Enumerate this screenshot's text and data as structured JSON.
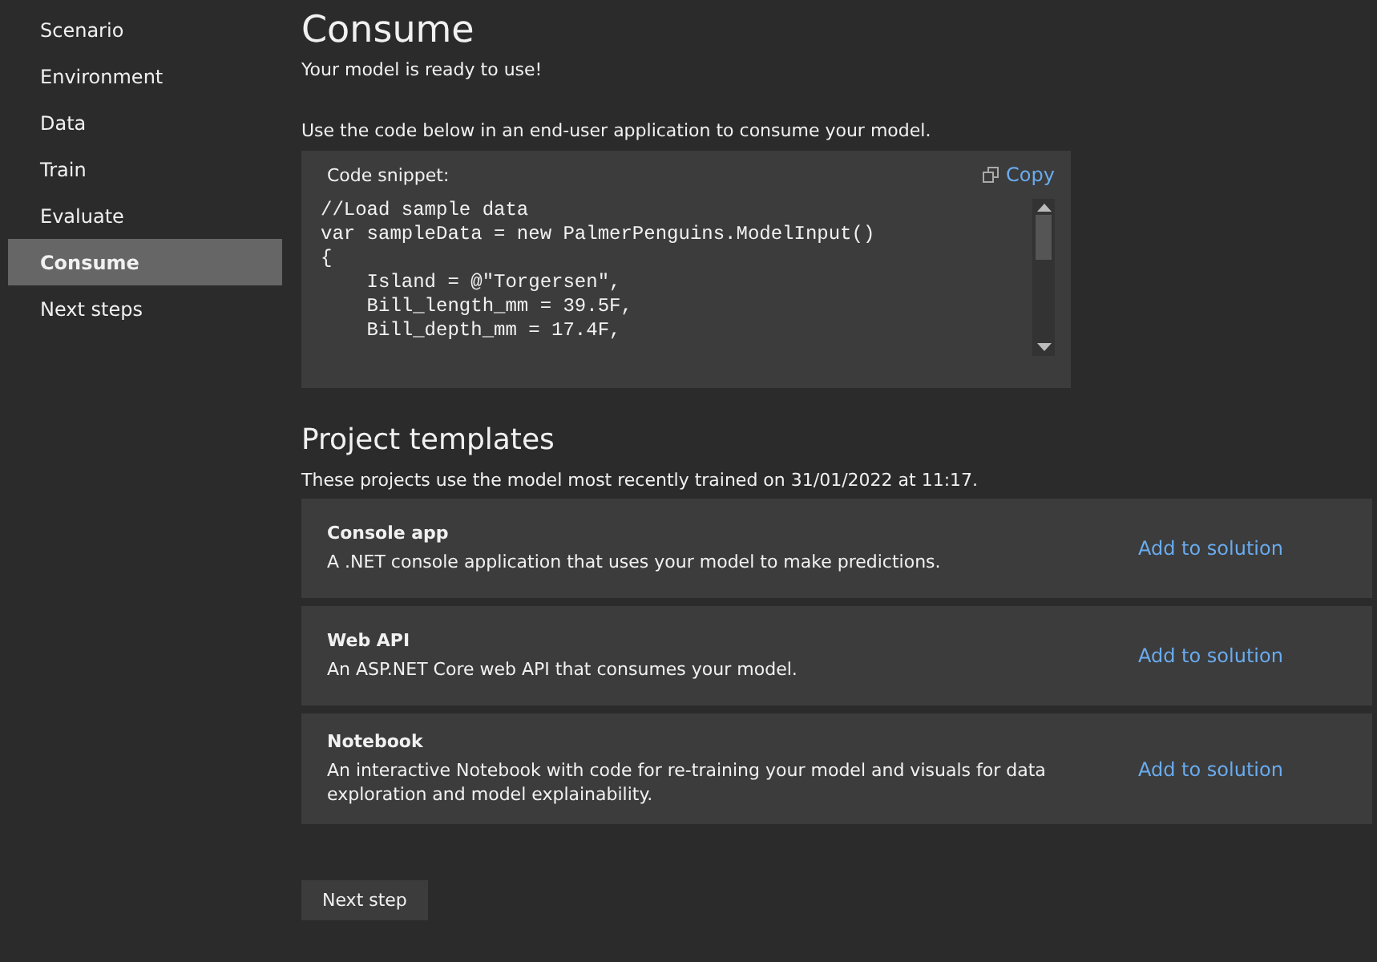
{
  "sidebar": {
    "items": [
      {
        "label": "Scenario",
        "selected": false
      },
      {
        "label": "Environment",
        "selected": false
      },
      {
        "label": "Data",
        "selected": false
      },
      {
        "label": "Train",
        "selected": false
      },
      {
        "label": "Evaluate",
        "selected": false
      },
      {
        "label": "Consume",
        "selected": true
      },
      {
        "label": "Next steps",
        "selected": false
      }
    ]
  },
  "page": {
    "title": "Consume",
    "subtitle": "Your model is ready to use!",
    "instruction": "Use the code below in an end-user application to consume your model."
  },
  "code_snippet": {
    "label": "Code snippet:",
    "copy_label": "Copy",
    "lines": [
      "//Load sample data",
      "var sampleData = new PalmerPenguins.ModelInput()",
      "{",
      "    Island = @\"Torgersen\",",
      "    Bill_length_mm = 39.5F,",
      "    Bill_depth_mm = 17.4F,"
    ]
  },
  "project_templates": {
    "title": "Project templates",
    "description": "These projects use the model most recently trained on 31/01/2022 at 11:17.",
    "items": [
      {
        "name": "Console app",
        "description": "A .NET console application that uses your model to make predictions.",
        "action": "Add to solution"
      },
      {
        "name": "Web API",
        "description": "An ASP.NET Core web API that consumes your model.",
        "action": "Add to solution"
      },
      {
        "name": "Notebook",
        "description": "An interactive Notebook with code for re-training your model and visuals for data exploration and model explainability.",
        "action": "Add to solution"
      }
    ]
  },
  "next_button": "Next step"
}
